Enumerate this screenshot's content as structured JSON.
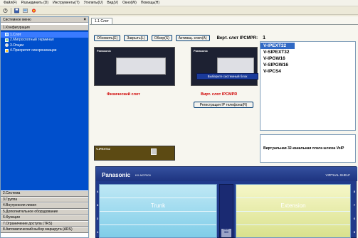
{
  "menubar": [
    "Файл(F)",
    "Разъединить (D)",
    "Инструменты(T)",
    "Утилиты(U)",
    "Вид(V)",
    "Окно(W)",
    "Помощь(H)"
  ],
  "toolbar": {
    "icons": [
      "connect-icon",
      "save-icon",
      "programming-icon",
      "tools-icon"
    ]
  },
  "sidebar": {
    "title": "Системное меню",
    "close": "×",
    "config_label": "1.Конфигурация",
    "items": [
      {
        "label": "1.Слот",
        "icon": "slot-icon",
        "selected": true
      },
      {
        "label": "2.Мигроспотный терминал",
        "icon": "terminal-icon",
        "selected": false
      },
      {
        "label": "3.Опции",
        "icon": "options-icon",
        "selected": false
      },
      {
        "label": "4.Приоритет синхронизации",
        "icon": "sync-icon",
        "selected": false
      }
    ],
    "categories": [
      "2.Система",
      "3.Группа",
      "4.Внутренняя линия",
      "5.Дополнительное оборудование",
      "6.Функции",
      "7.Ограничение доступа (TRS)",
      "8.Автоматический выбор маршрута (ARS)"
    ]
  },
  "content": {
    "tab_label": "1.1 Слот",
    "buttons": {
      "refresh": "Обновить(E)",
      "close": "Закрыть(L)",
      "overview": "Обзор(S)",
      "activation": "Активац. ключ(A)"
    },
    "ipcmr_label": "Верт. слот IPCMPR:",
    "ipcmr_count": "1",
    "phys_brand": "Panasonic",
    "phys_label": "Физический слот",
    "virt_brand": "Panasonic",
    "virt_tip": "Выберите системный блок",
    "virt_label": "Вирт. слот IPCMPR",
    "register_button": "Регистрация IP телефона(R)",
    "card_types": [
      {
        "label": "V-IPEXT32",
        "selected": true
      },
      {
        "label": "V-SIPEXT32",
        "selected": false
      },
      {
        "label": "V-IPGW16",
        "selected": false
      },
      {
        "label": "V-SIPGW16",
        "selected": false
      },
      {
        "label": "V-IPCS4",
        "selected": false
      }
    ],
    "card_label": "V-IPEXT32",
    "card_description": "Виртуальная 32-канальная плата шлюза VoIP"
  },
  "shelf": {
    "brand": "Panasonic",
    "model": "KX-NCP500",
    "title": "VIRTUAL SHELF",
    "trunk_label": "Trunk",
    "extension_label": "Extension",
    "center_label": "NCP 500",
    "left_slots": [
      "4",
      "3",
      "2",
      "1"
    ],
    "right_slots": [
      "8",
      "7",
      "6",
      "5"
    ]
  },
  "colors": {
    "sidebar_blue": "#004fcc",
    "selected_blue": "#316ac5",
    "label_red": "#d00000",
    "shelf_blue": "#213a8b"
  }
}
